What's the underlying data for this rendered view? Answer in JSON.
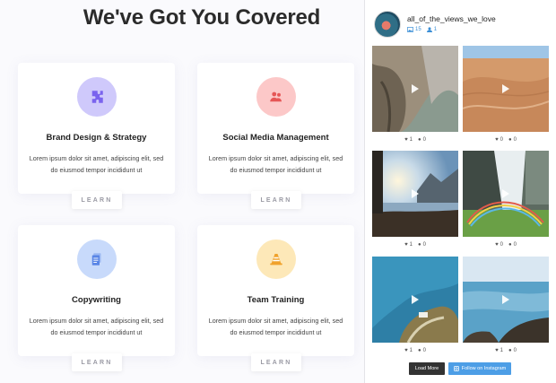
{
  "services": {
    "heading": "We've Got You Covered",
    "cards": [
      {
        "title": "Brand Design & Strategy",
        "desc": "Lorem ipsum dolor sit amet, adipiscing elit, sed do eiusmod tempor incididunt ut",
        "button": "LEARN",
        "icon": "puzzle-icon",
        "icon_bg": "#cfc9fb",
        "icon_color": "#7a63ee"
      },
      {
        "title": "Social Media Management",
        "desc": "Lorem ipsum dolor sit amet, adipiscing elit, sed do eiusmod tempor incididunt ut",
        "button": "LEARN",
        "icon": "users-icon",
        "icon_bg": "#fcc8c8",
        "icon_color": "#e65656"
      },
      {
        "title": "Copywriting",
        "desc": "Lorem ipsum dolor sit amet, adipiscing elit, sed do eiusmod tempor incididunt ut",
        "button": "LEARN",
        "icon": "documents-icon",
        "icon_bg": "#c8dafb",
        "icon_color": "#5a86e6"
      },
      {
        "title": "Team Training",
        "desc": "Lorem ipsum dolor sit amet, adipiscing elit, sed do eiusmod tempor incididunt ut",
        "button": "LEARN",
        "icon": "cone-icon",
        "icon_bg": "#fde8b8",
        "icon_color": "#f0a22c"
      }
    ]
  },
  "instagram": {
    "username": "all_of_the_views_we_love",
    "posts_count": "15",
    "followers_count": "1",
    "accent_color": "#3a8ed6",
    "photos": [
      {
        "likes": "1",
        "comments": "0",
        "scene": "canyon cliffs"
      },
      {
        "likes": "0",
        "comments": "0",
        "scene": "desert dunes"
      },
      {
        "likes": "1",
        "comments": "0",
        "scene": "lake at sunset"
      },
      {
        "likes": "0",
        "comments": "0",
        "scene": "waterfall rainbow"
      },
      {
        "likes": "1",
        "comments": "0",
        "scene": "sea cliffs"
      },
      {
        "likes": "1",
        "comments": "0",
        "scene": "ocean rocks"
      }
    ],
    "load_more_label": "Load More",
    "follow_label": "Follow on Instagram"
  }
}
